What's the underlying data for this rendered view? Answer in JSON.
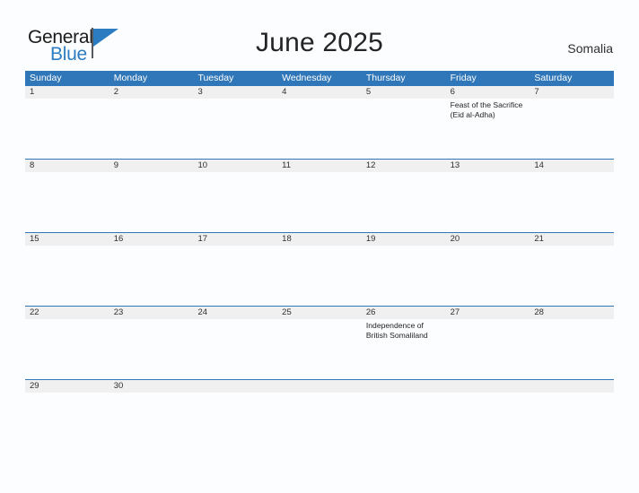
{
  "brand": {
    "name_part1": "General",
    "name_part2": "Blue",
    "flag_icon": "flag-triangle-icon"
  },
  "header": {
    "title": "June 2025",
    "country": "Somalia"
  },
  "calendar": {
    "weekdays": [
      "Sunday",
      "Monday",
      "Tuesday",
      "Wednesday",
      "Thursday",
      "Friday",
      "Saturday"
    ],
    "colors": {
      "header_blue": "#3077b9",
      "row_divider_blue": "#3077b9",
      "day_strip_gray": "#f0f0f0",
      "page_background": "#fcfdff",
      "brand_blue": "#2b7cc0"
    },
    "weeks": [
      {
        "days": [
          {
            "number": "1",
            "events": []
          },
          {
            "number": "2",
            "events": []
          },
          {
            "number": "3",
            "events": []
          },
          {
            "number": "4",
            "events": []
          },
          {
            "number": "5",
            "events": []
          },
          {
            "number": "6",
            "events": [
              "Feast of the Sacrifice (Eid al-Adha)"
            ]
          },
          {
            "number": "7",
            "events": []
          }
        ]
      },
      {
        "days": [
          {
            "number": "8",
            "events": []
          },
          {
            "number": "9",
            "events": []
          },
          {
            "number": "10",
            "events": []
          },
          {
            "number": "11",
            "events": []
          },
          {
            "number": "12",
            "events": []
          },
          {
            "number": "13",
            "events": []
          },
          {
            "number": "14",
            "events": []
          }
        ]
      },
      {
        "days": [
          {
            "number": "15",
            "events": []
          },
          {
            "number": "16",
            "events": []
          },
          {
            "number": "17",
            "events": []
          },
          {
            "number": "18",
            "events": []
          },
          {
            "number": "19",
            "events": []
          },
          {
            "number": "20",
            "events": []
          },
          {
            "number": "21",
            "events": []
          }
        ]
      },
      {
        "days": [
          {
            "number": "22",
            "events": []
          },
          {
            "number": "23",
            "events": []
          },
          {
            "number": "24",
            "events": []
          },
          {
            "number": "25",
            "events": []
          },
          {
            "number": "26",
            "events": [
              "Independence of British Somaliland"
            ]
          },
          {
            "number": "27",
            "events": []
          },
          {
            "number": "28",
            "events": []
          }
        ]
      },
      {
        "short": true,
        "days": [
          {
            "number": "29",
            "events": []
          },
          {
            "number": "30",
            "events": []
          },
          {
            "number": "",
            "events": []
          },
          {
            "number": "",
            "events": []
          },
          {
            "number": "",
            "events": []
          },
          {
            "number": "",
            "events": []
          },
          {
            "number": "",
            "events": []
          }
        ]
      }
    ]
  }
}
